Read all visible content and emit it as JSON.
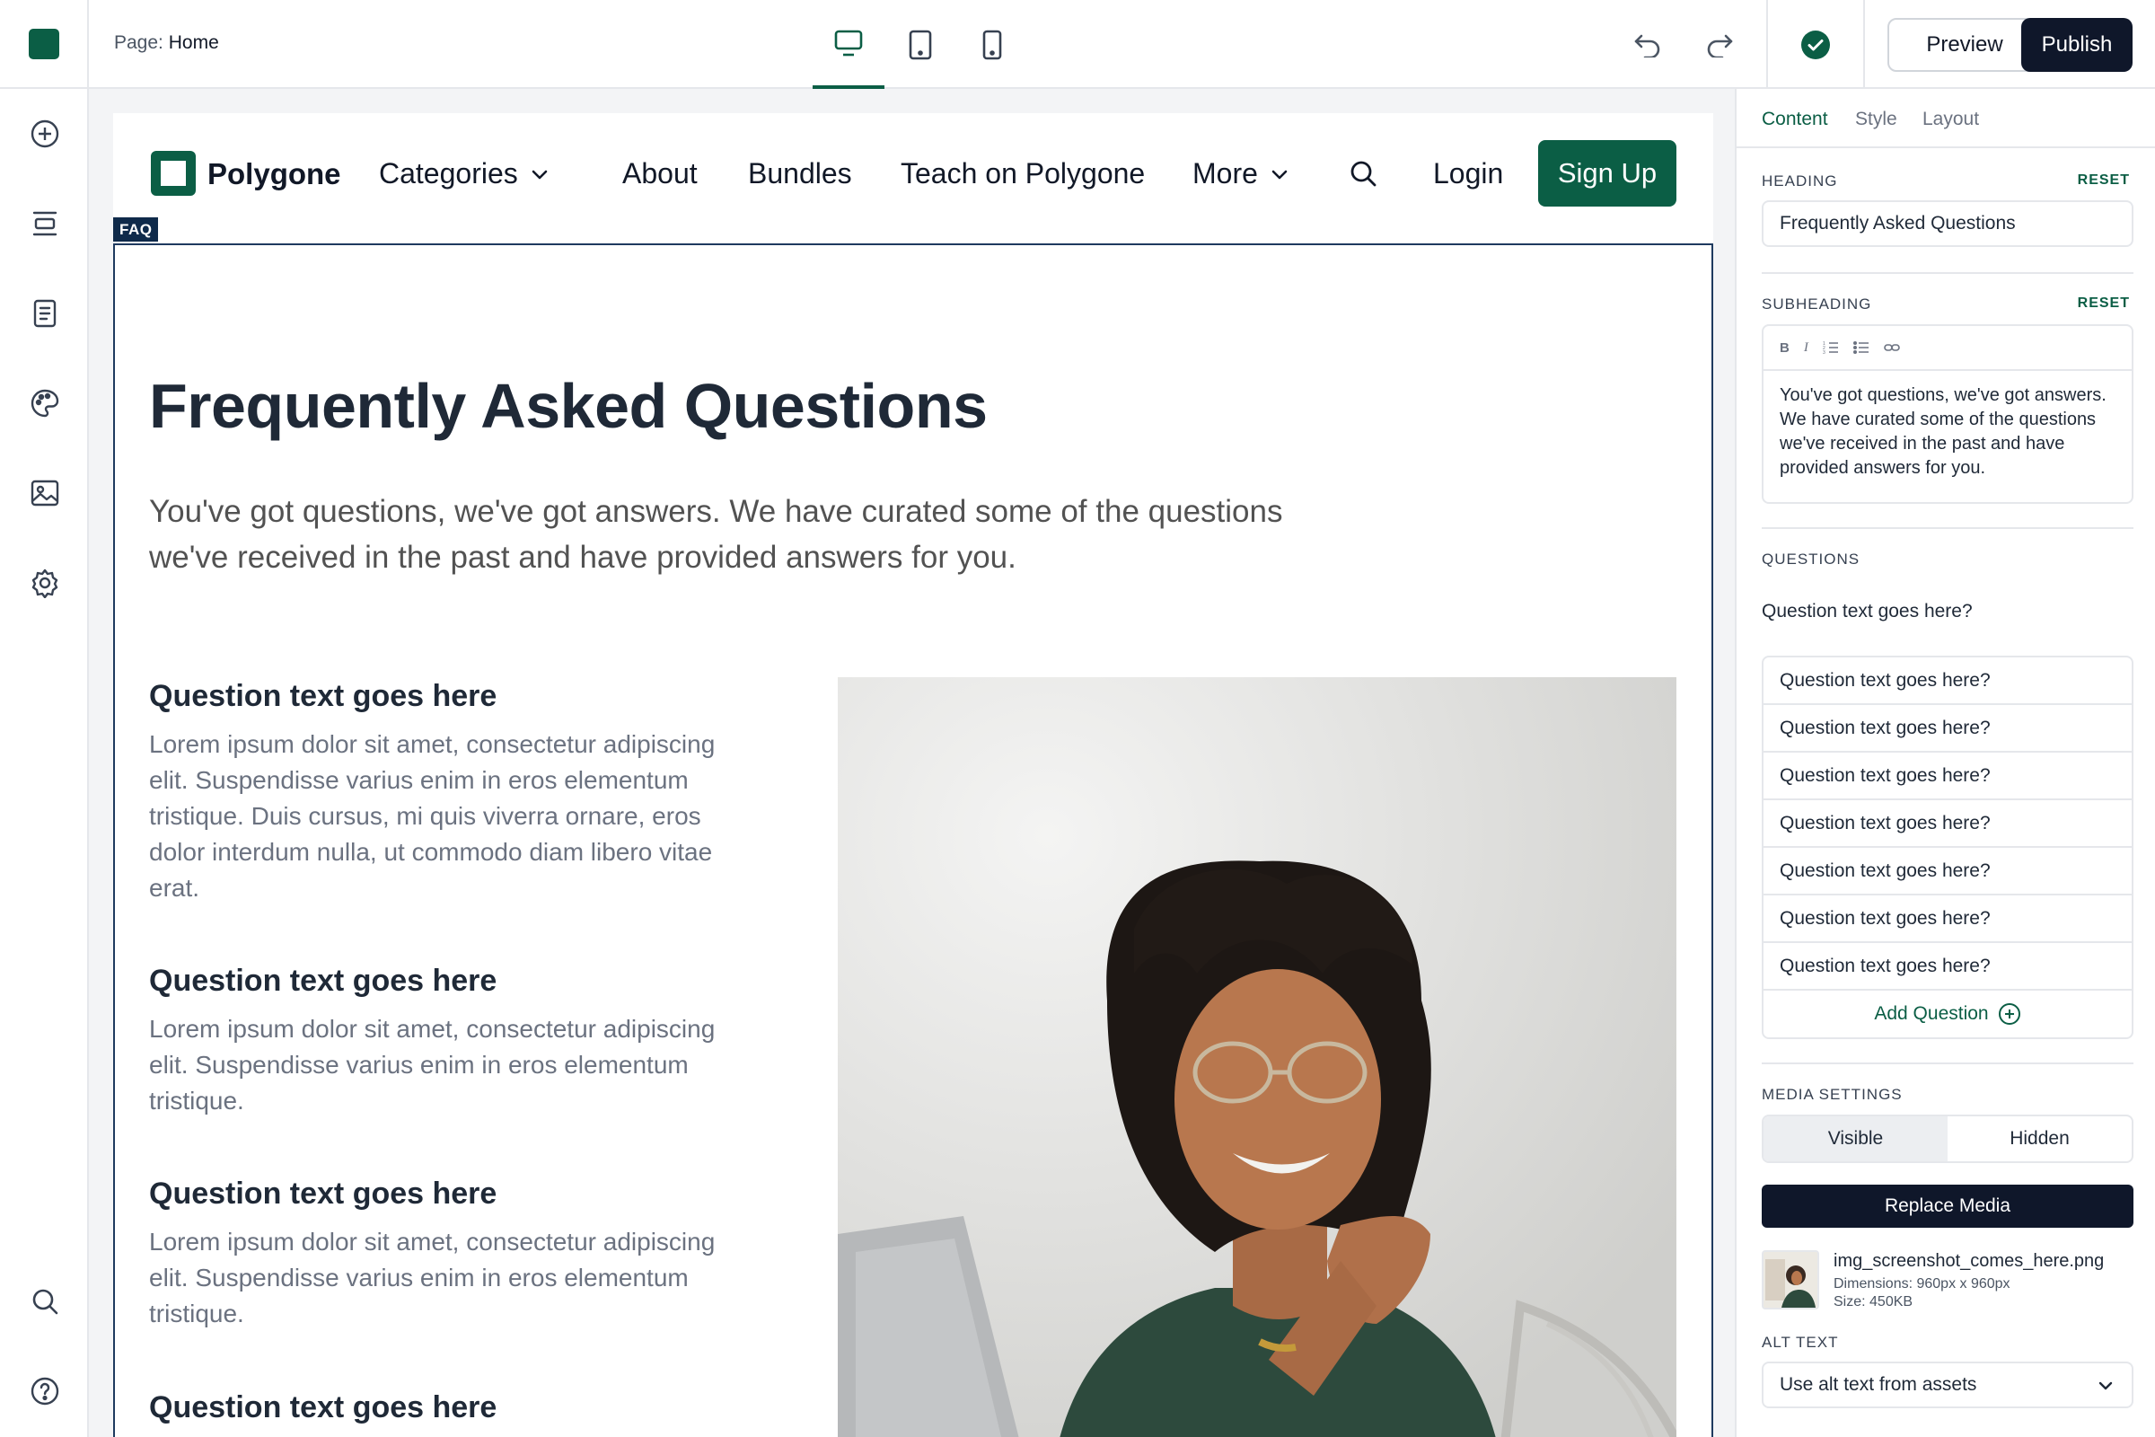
{
  "topbar": {
    "page_prefix": "Page:",
    "page_name": "Home",
    "preview_label": "Preview",
    "publish_label": "Publish",
    "brand_color": "#0b5e45"
  },
  "site": {
    "brand": "Polygone",
    "nav": {
      "categories": "Categories",
      "about": "About",
      "bundles": "Bundles",
      "teach": "Teach on Polygone",
      "more": "More",
      "login": "Login",
      "signup": "Sign Up"
    },
    "section_tag": "FAQ",
    "faq": {
      "title": "Frequently Asked Questions",
      "subtitle": "You've got questions, we've got answers. We have curated some of the questions we've received in the past and have provided answers for you.",
      "items": [
        {
          "q": "Question text goes here",
          "a": "Lorem ipsum dolor sit amet, consectetur adipiscing elit. Suspendisse varius enim in eros elementum tristique. Duis cursus, mi quis viverra ornare, eros dolor interdum nulla, ut commodo diam libero vitae erat."
        },
        {
          "q": "Question text goes here",
          "a": "Lorem ipsum dolor sit amet, consectetur adipiscing elit. Suspendisse varius enim in eros elementum tristique."
        },
        {
          "q": "Question text goes here",
          "a": "Lorem ipsum dolor sit amet, consectetur adipiscing elit. Suspendisse varius enim in eros elementum tristique."
        },
        {
          "q": "Question text goes here",
          "a": ""
        }
      ]
    }
  },
  "panel": {
    "tabs": [
      "Content",
      "Style",
      "Layout"
    ],
    "heading": {
      "label": "HEADING",
      "reset": "RESET",
      "value": "Frequently Asked Questions"
    },
    "subheading": {
      "label": "SUBHEADING",
      "reset": "RESET",
      "tools": [
        "B",
        "I"
      ],
      "value": "You've got questions, we've got answers. We have curated some of the questions we've received in the past and have provided answers for you."
    },
    "questions": {
      "label": "QUESTIONS",
      "selected": "Question text goes here?",
      "list": [
        "Question text goes here?",
        "Question text goes here?",
        "Question text goes here?",
        "Question text goes here?",
        "Question text goes here?",
        "Question text goes here?",
        "Question text goes here?"
      ],
      "add_label": "Add Question"
    },
    "media": {
      "label": "MEDIA SETTINGS",
      "options": [
        "Visible",
        "Hidden"
      ],
      "selected": "Visible",
      "replace_label": "Replace Media",
      "file_name": "img_screenshot_comes_here.png",
      "dimensions": "Dimensions: 960px x 960px",
      "size": "Size: 450KB"
    },
    "alt_text": {
      "label": "ALT TEXT",
      "value": "Use alt text from assets"
    }
  },
  "icons": {
    "rail": [
      "plus-circle-icon",
      "sections-icon",
      "document-icon",
      "palette-icon",
      "image-icon",
      "gear-icon",
      "search-icon",
      "help-icon"
    ],
    "devices": [
      "desktop-icon",
      "tablet-icon",
      "mobile-icon"
    ],
    "history": [
      "undo-icon",
      "redo-icon"
    ],
    "status": "check-circle-icon"
  }
}
